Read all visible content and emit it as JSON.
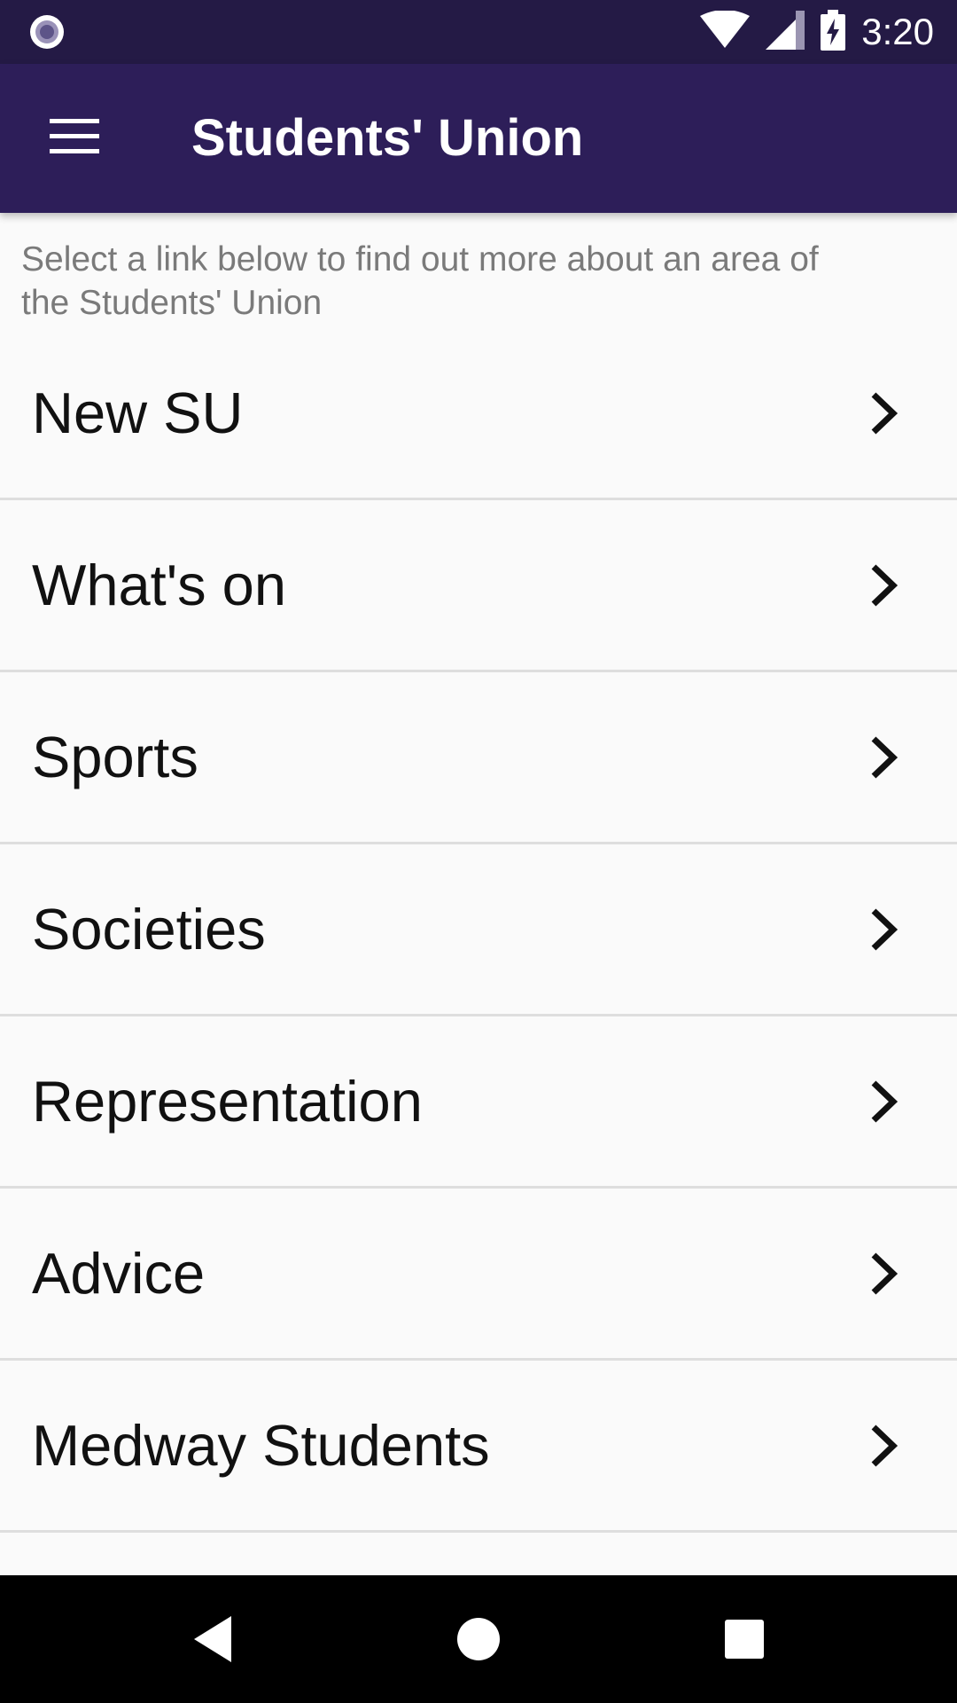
{
  "status_bar": {
    "time": "3:20",
    "icons": [
      "notification-dot-icon",
      "wifi-icon",
      "signal-icon",
      "battery-charging-icon"
    ]
  },
  "app_bar": {
    "title": "Students' Union",
    "menu_icon": "hamburger-menu-icon"
  },
  "intro": {
    "text": "Select a link below to find out more about an area of the Students' Union"
  },
  "menu": {
    "items": [
      {
        "label": "New SU",
        "icon": "chevron-right-icon"
      },
      {
        "label": "What's on",
        "icon": "chevron-right-icon"
      },
      {
        "label": "Sports",
        "icon": "chevron-right-icon"
      },
      {
        "label": "Societies",
        "icon": "chevron-right-icon"
      },
      {
        "label": "Representation",
        "icon": "chevron-right-icon"
      },
      {
        "label": "Advice",
        "icon": "chevron-right-icon"
      },
      {
        "label": "Medway Students",
        "icon": "chevron-right-icon"
      }
    ]
  },
  "nav_bar": {
    "icons": [
      "back-icon",
      "home-icon",
      "recents-icon"
    ]
  },
  "colors": {
    "status_bar": "#241a45",
    "app_bar": "#2d1e59",
    "background": "#fafafa",
    "divider": "#dedede",
    "intro_text": "#7a7a7a",
    "item_text": "#111111"
  }
}
